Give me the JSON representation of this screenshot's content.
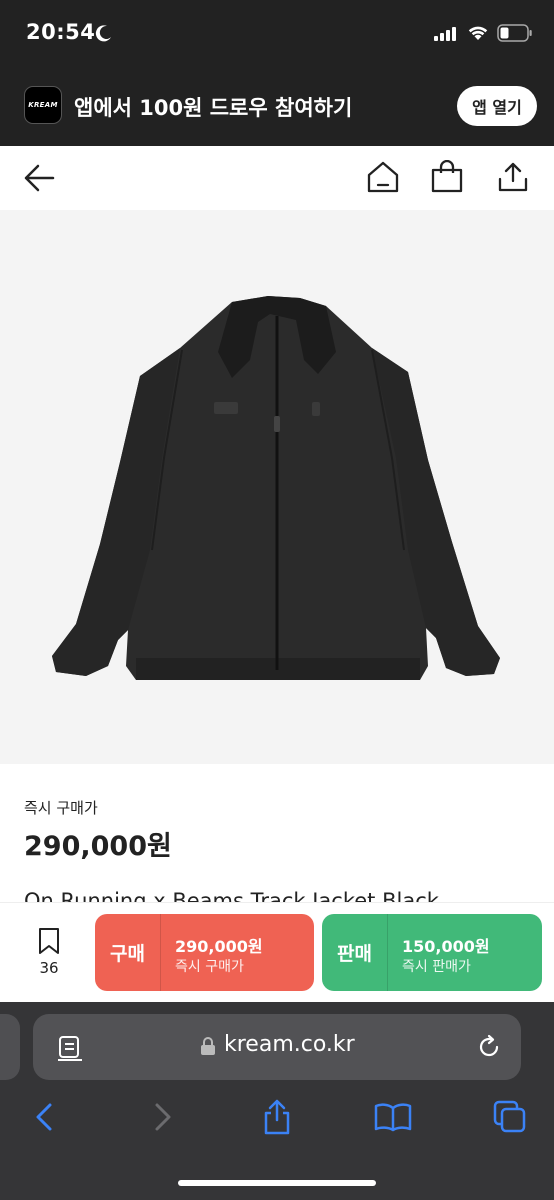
{
  "status_bar": {
    "time": "20:54"
  },
  "banner": {
    "logo_text": "KREAM",
    "text": "앱에서 100원 드로우 참여하기",
    "open_button": "앱 열기"
  },
  "nav": {
    "icons": [
      "back-arrow-icon",
      "home-icon",
      "shopping-bag-icon",
      "share-icon"
    ]
  },
  "product": {
    "image_alt": "black track jacket",
    "price_label": "즉시 구매가",
    "price": "290,000원",
    "title": "On Running x Beams Track Jacket Black"
  },
  "bottom_bar": {
    "wish_count": "36",
    "buy": {
      "label": "구매",
      "price": "290,000원",
      "sub": "즉시 구매가"
    },
    "sell": {
      "label": "판매",
      "price": "150,000원",
      "sub": "즉시 판매가"
    }
  },
  "browser": {
    "url": "kream.co.kr"
  },
  "colors": {
    "buy": "#ef6253",
    "sell": "#41b979",
    "header_bg": "#222222",
    "safari_bg": "#353537"
  }
}
